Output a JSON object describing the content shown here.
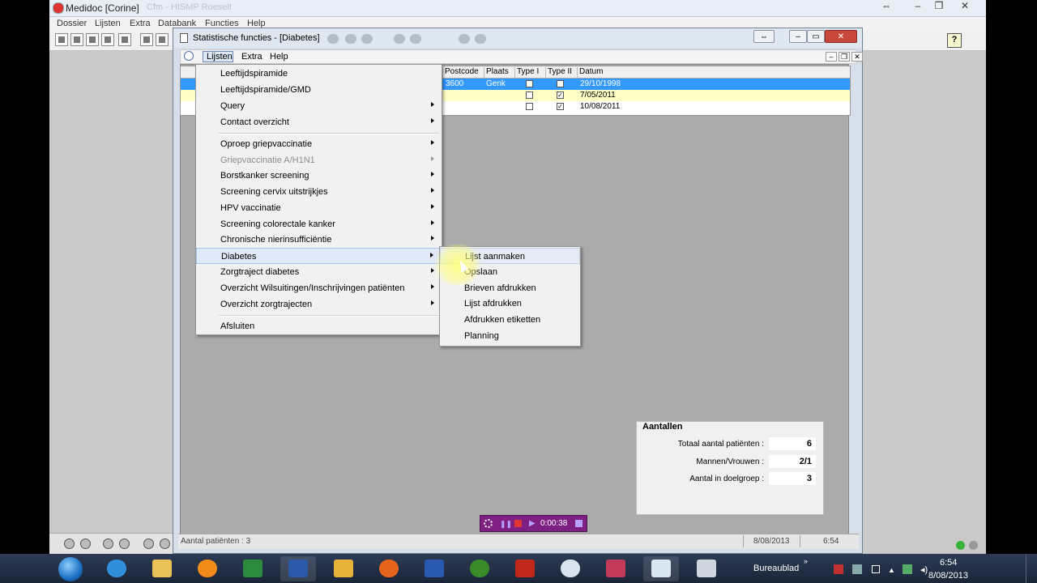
{
  "app": {
    "title": "Medidoc [Corine]",
    "title_faded": "Cfm - HISMP Roeselt",
    "menu": [
      "Dossier",
      "Lijsten",
      "Extra",
      "Databank",
      "Functies",
      "Help"
    ]
  },
  "window": {
    "title": "Statistische functies - [Diabetes]",
    "menu": [
      "Lijsten",
      "Extra",
      "Help"
    ]
  },
  "grid": {
    "columns": [
      "Postcode",
      "Plaats",
      "Type I",
      "Type II",
      "Datum"
    ],
    "rows": [
      {
        "postcode": "3600",
        "plaats": "Genk",
        "type1": false,
        "type2": true,
        "datum": "29/10/1998",
        "selected": true
      },
      {
        "postcode": "",
        "plaats": "",
        "type1": false,
        "type2": true,
        "datum": "7/05/2011",
        "selected": false
      },
      {
        "postcode": "",
        "plaats": "",
        "type1": false,
        "type2": true,
        "datum": "10/08/2011",
        "selected": false
      }
    ],
    "colors": {
      "selected": "#3399ff",
      "highlight": "#ffffc6"
    }
  },
  "lijsten_menu": {
    "items": [
      {
        "label": "Leeftijdspiramide",
        "submenu": false,
        "disabled": false
      },
      {
        "label": "Leeftijdspiramide/GMD",
        "submenu": false,
        "disabled": false
      },
      {
        "label": "Query",
        "submenu": true,
        "disabled": false
      },
      {
        "label": "Contact overzicht",
        "submenu": true,
        "disabled": false
      },
      {
        "label": "Oproep griepvaccinatie",
        "submenu": true,
        "disabled": false
      },
      {
        "label": "Griepvaccinatie A/H1N1",
        "submenu": true,
        "disabled": true
      },
      {
        "label": "Borstkanker screening",
        "submenu": true,
        "disabled": false
      },
      {
        "label": "Screening cervix uitstrijkjes",
        "submenu": true,
        "disabled": false
      },
      {
        "label": "HPV vaccinatie",
        "submenu": true,
        "disabled": false
      },
      {
        "label": "Screening colorectale kanker",
        "submenu": true,
        "disabled": false
      },
      {
        "label": "Chronische nierinsufficiëntie",
        "submenu": true,
        "disabled": false
      },
      {
        "label": "Diabetes",
        "submenu": true,
        "disabled": false
      },
      {
        "label": "Zorgtraject diabetes",
        "submenu": true,
        "disabled": false
      },
      {
        "label": "Overzicht Wilsuitingen/Inschrijvingen patiënten",
        "submenu": true,
        "disabled": false
      },
      {
        "label": "Overzicht zorgtrajecten",
        "submenu": true,
        "disabled": false
      },
      {
        "label": "Afsluiten",
        "submenu": false,
        "disabled": false
      }
    ]
  },
  "diabetes_submenu": {
    "items": [
      "Lijst aanmaken",
      "Opslaan",
      "Brieven afdrukken",
      "Lijst afdrukken",
      "Afdrukken etiketten",
      "Planning"
    ]
  },
  "aantallen": {
    "title": "Aantallen",
    "rows": [
      {
        "label": "Totaal aantal patiënten :",
        "value": "6"
      },
      {
        "label": "Mannen/Vrouwen :",
        "value": "2/1"
      },
      {
        "label": "Aantal in doelgroep :",
        "value": "3"
      }
    ]
  },
  "recorder": {
    "time": "0:00:38"
  },
  "statusbar": {
    "left": "Aantal patiënten : 3",
    "date": "8/08/2013",
    "time": "6:54"
  },
  "taskbar": {
    "desktop_label": "Bureaublad",
    "clock_time": "6:54",
    "clock_date": "8/08/2013",
    "icons": [
      "ie-icon",
      "explorer-icon",
      "media-player-icon",
      "excel-icon",
      "word-icon",
      "outlook-icon",
      "firefox-icon",
      "save-icon",
      "sync-icon",
      "filezilla-icon",
      "gauge-icon",
      "help-icon",
      "medidoc-icon",
      "network-icon"
    ]
  }
}
